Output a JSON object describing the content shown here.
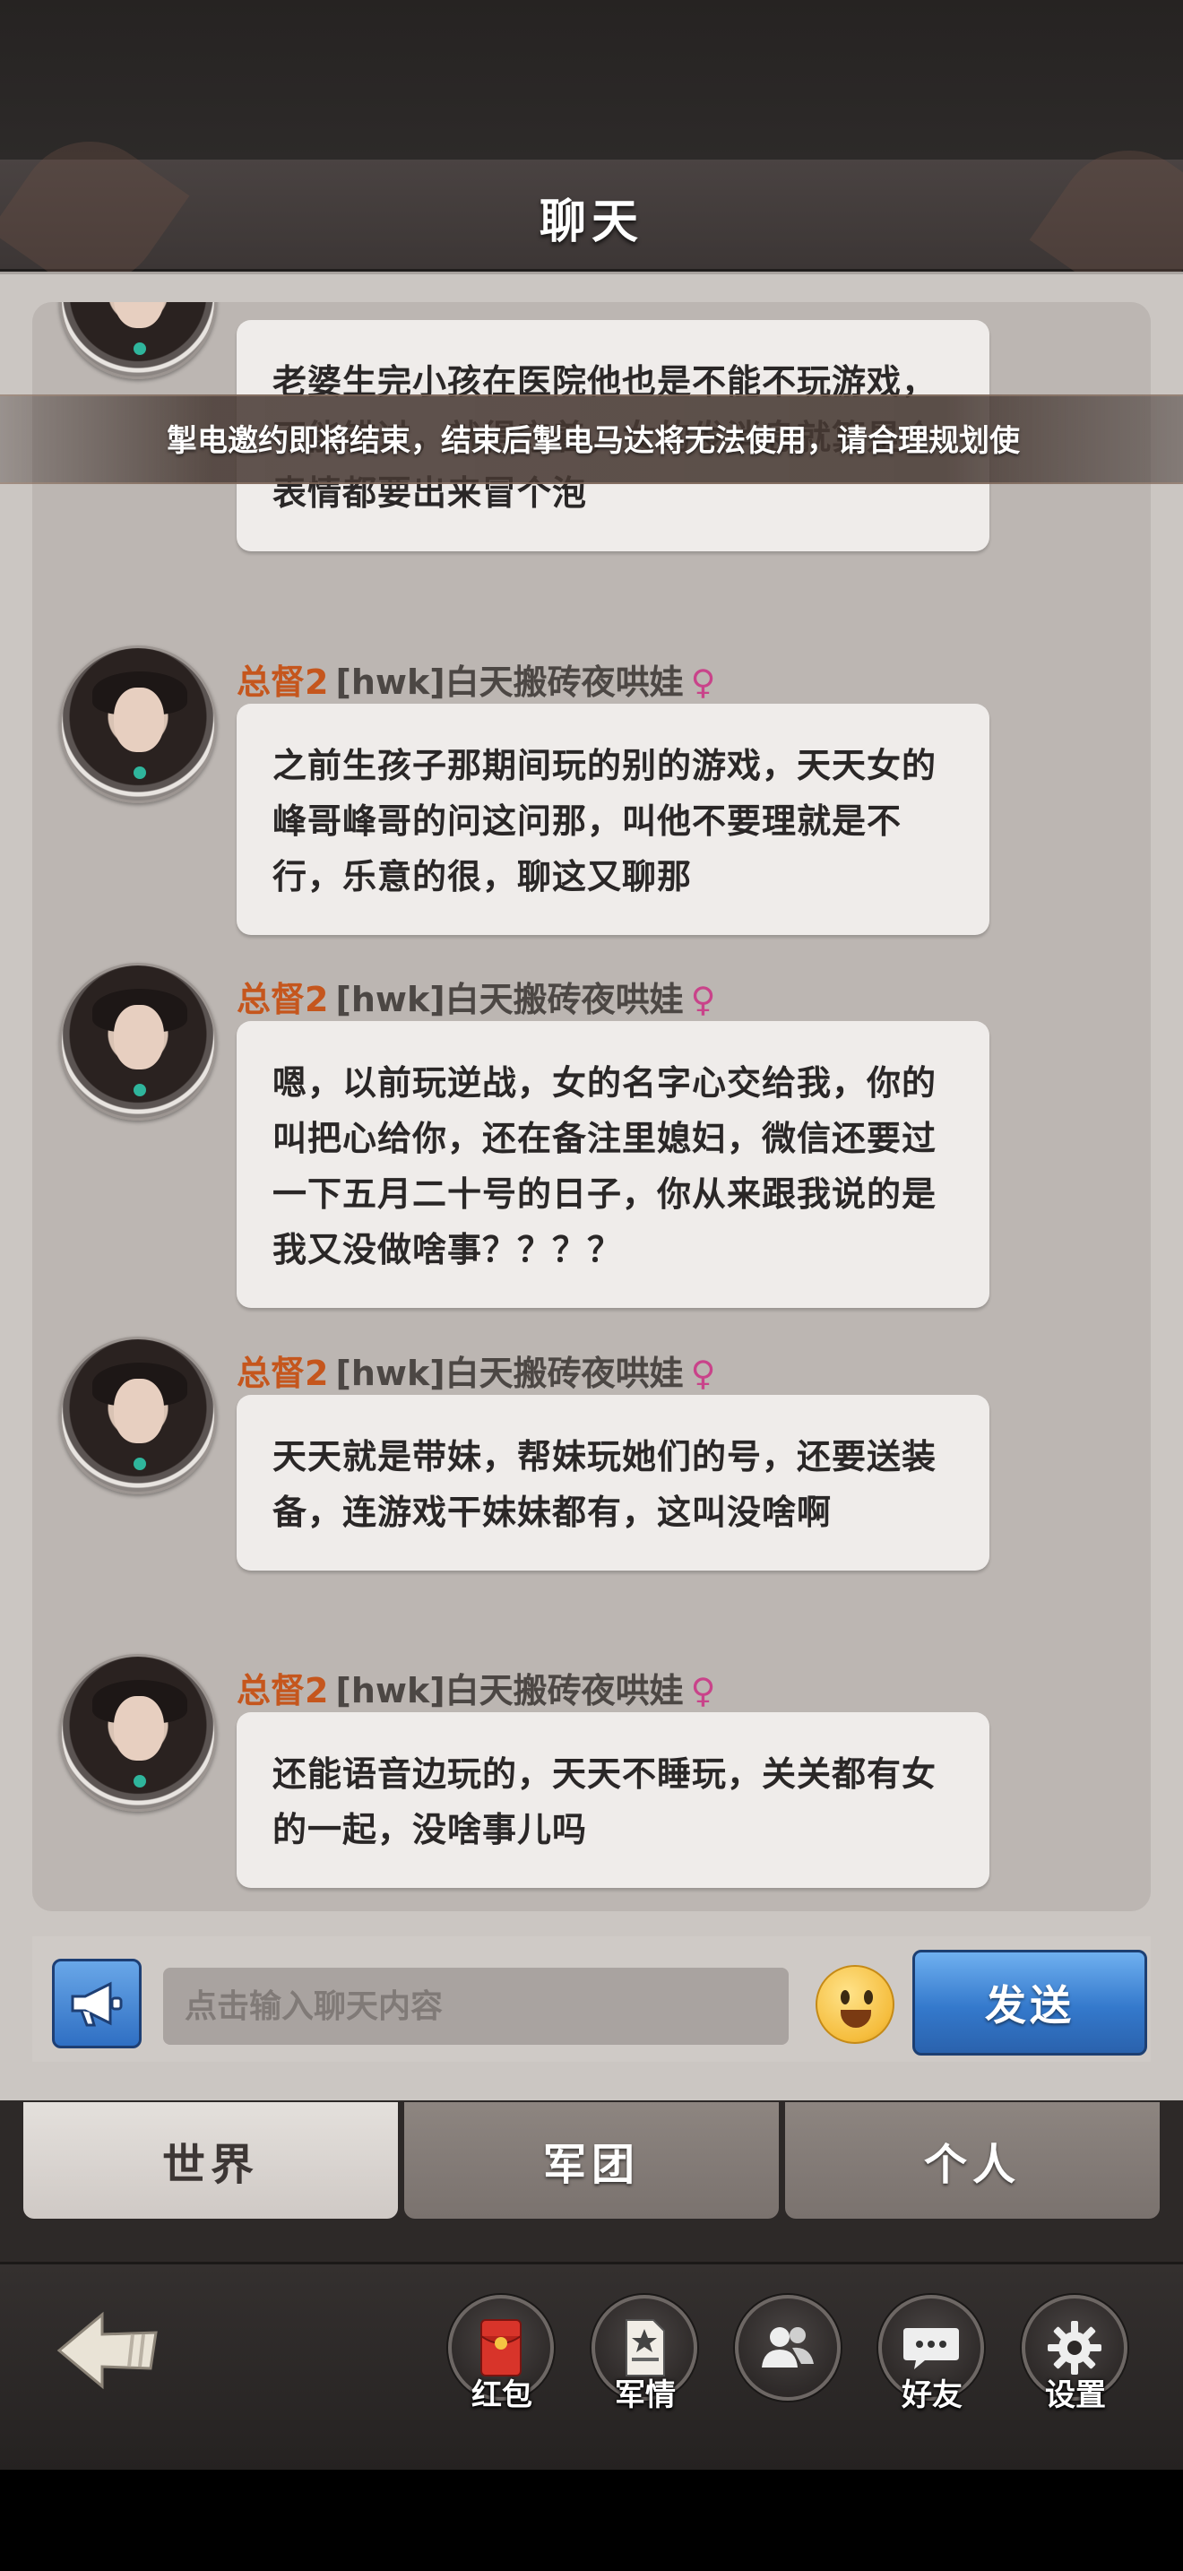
{
  "header": {
    "title": "聊天"
  },
  "banner": {
    "text": "掣电邀约即将结束，结束后掣电马达将无法使用，请合理规划使"
  },
  "messages": [
    {
      "rank": "",
      "guild": "",
      "name": "",
      "gender": "",
      "text": "老婆生完小孩在医院他也是不能不玩游戏，不能错过，就得守着，女的发消息就算是个表情都要出来冒个泡"
    },
    {
      "rank": "总督2",
      "guild": "[hwk]",
      "name": "白天搬砖夜哄娃",
      "gender": "♀",
      "text": "之前生孩子那期间玩的别的游戏，天天女的峰哥峰哥的问这问那，叫他不要理就是不行，乐意的很，聊这又聊那"
    },
    {
      "rank": "总督2",
      "guild": "[hwk]",
      "name": "白天搬砖夜哄娃",
      "gender": "♀",
      "text": "嗯，以前玩逆战，女的名字心交给我，你的叫把心给你，还在备注里媳妇，微信还要过一下五月二十号的日子，你从来跟我说的是我又没做啥事？？？？"
    },
    {
      "rank": "总督2",
      "guild": "[hwk]",
      "name": "白天搬砖夜哄娃",
      "gender": "♀",
      "text": "天天就是带妹，帮妹玩她们的号，还要送装备，连游戏干妹妹都有，这叫没啥啊"
    },
    {
      "rank": "总督2",
      "guild": "[hwk]",
      "name": "白天搬砖夜哄娃",
      "gender": "♀",
      "text": "还能语音边玩的，天天不睡玩，关关都有女的一起，没啥事儿吗"
    }
  ],
  "input": {
    "placeholder": "点击输入聊天内容",
    "send_label": "发送"
  },
  "tabs": [
    {
      "label": "世界",
      "active": true
    },
    {
      "label": "军团",
      "active": false
    },
    {
      "label": "个人",
      "active": false
    }
  ],
  "dock": [
    {
      "label": "红包",
      "icon": "red-envelope-icon"
    },
    {
      "label": "军情",
      "icon": "document-star-icon"
    },
    {
      "label": "",
      "icon": "group-icon"
    },
    {
      "label": "好友",
      "icon": "chat-bubble-icon"
    },
    {
      "label": "设置",
      "icon": "gear-icon"
    }
  ],
  "colors": {
    "send_button": "#3479cc",
    "rank": "#c5561d",
    "gender": "#c9438a"
  }
}
